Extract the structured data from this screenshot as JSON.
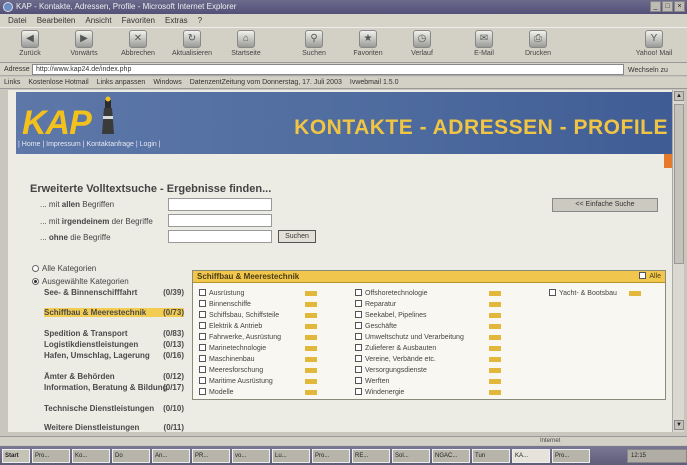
{
  "window": {
    "title": "KAP - Kontakte, Adressen, Profile - Microsoft Internet Explorer"
  },
  "menu": [
    "Datei",
    "Bearbeiten",
    "Ansicht",
    "Favoriten",
    "Extras",
    "?"
  ],
  "toolbar": [
    {
      "label": "Zurück",
      "icon": "back-arrow-icon"
    },
    {
      "label": "Vorwärts",
      "icon": "forward-arrow-icon"
    },
    {
      "label": "Abbrechen",
      "icon": "stop-icon"
    },
    {
      "label": "Aktualisieren",
      "icon": "refresh-icon"
    },
    {
      "label": "Startseite",
      "icon": "home-icon"
    },
    {
      "label": "Suchen",
      "icon": "search-icon"
    },
    {
      "label": "Favoriten",
      "icon": "favorites-icon"
    },
    {
      "label": "Verlauf",
      "icon": "history-icon"
    },
    {
      "label": "E-Mail",
      "icon": "mail-icon"
    },
    {
      "label": "Drucken",
      "icon": "print-icon"
    },
    {
      "label": "Yahoo! Mail",
      "icon": "yahoo-mail-icon"
    }
  ],
  "address": {
    "label": "Adresse",
    "url": "http://www.kap24.de/index.php",
    "go": "Wechseln zu"
  },
  "links": {
    "label": "Links",
    "items": [
      "Kostenlose Hotmail",
      "Links anpassen",
      "Windows",
      "DatenzentZeitung vom Donnerstag, 17. Juli 2003",
      "Ivwebmail 1.5.0"
    ]
  },
  "banner": {
    "logo": "KAP",
    "headline": "KONTAKTE - ADRESSEN - PROFILE",
    "nav": "| Home | Impressum | Kontaktanfrage | Login |"
  },
  "search": {
    "title": "Erweiterte Volltextsuche - Ergebnisse finden...",
    "rows": [
      {
        "prefix": "... mit ",
        "bold": "allen",
        "suffix": " Begriffen"
      },
      {
        "prefix": "... mit ",
        "bold": "irgendeinem",
        "suffix": " der Begriffe"
      },
      {
        "prefix": "... ",
        "bold": "ohne",
        "suffix": " die Begriffe"
      }
    ],
    "button": "Suchen",
    "simple_search": "<< Einfache Suche"
  },
  "categories": {
    "all_label": "Alle Kategorien",
    "selected_label": "Ausgewählte Kategorien",
    "items": [
      {
        "name": "See- & Binnenschifffahrt",
        "count": "(0/39)",
        "selected": false
      },
      {
        "name": "Schiffbau & Meerestechnik",
        "count": "(0/73)",
        "selected": true
      },
      {
        "name": "Spedition & Transport",
        "count": "(0/83)",
        "selected": false
      },
      {
        "name": "Logistikdienstleistungen",
        "count": "(0/13)",
        "selected": false
      },
      {
        "name": "Hafen, Umschlag, Lagerung",
        "count": "(0/16)",
        "selected": false
      },
      {
        "name": "Ämter & Behörden",
        "count": "(0/12)",
        "selected": false
      },
      {
        "name": "Information, Beratung & Bildung",
        "count": "(0/17)",
        "selected": false
      },
      {
        "name": "Technische Dienstleistungen",
        "count": "(0/10)",
        "selected": false
      },
      {
        "name": "Weitere Dienstleistungen",
        "count": "(0/11)",
        "selected": false
      }
    ]
  },
  "panel": {
    "title": "Schiffbau & Meerestechnik",
    "all_label": "Alle",
    "columns": [
      [
        "Ausrüstung",
        "Binnenschiffe",
        "Schiffsbau, Schiffsteile",
        "Elektrik & Antrieb",
        "Fahrwerke, Ausrüstung",
        "Marinetechnologie",
        "Maschinenbau",
        "Meeresforschung",
        "Maritime Ausrüstung",
        "Modelle"
      ],
      [
        "Offshoretechnologie",
        "Reparatur",
        "Seekabel, Pipelines",
        "Geschäfte",
        "Umweltschutz und Verarbeitung",
        "Zulieferer & Ausbauten",
        "Vereine, Verbände etc.",
        "Versorgungsdienste",
        "Werften",
        "Windenergie"
      ],
      [
        "Yacht- & Bootsbau"
      ]
    ]
  },
  "status": {
    "zone": "Internet"
  },
  "taskbar": [
    "Start",
    "Pro...",
    "Ko...",
    "Do",
    "An...",
    "PR...",
    "vo...",
    "Lu...",
    "Pro...",
    "RE...",
    "Sol...",
    "NGAC...",
    "Tun",
    "KA...",
    "Pro..."
  ],
  "clock": "12:15"
}
